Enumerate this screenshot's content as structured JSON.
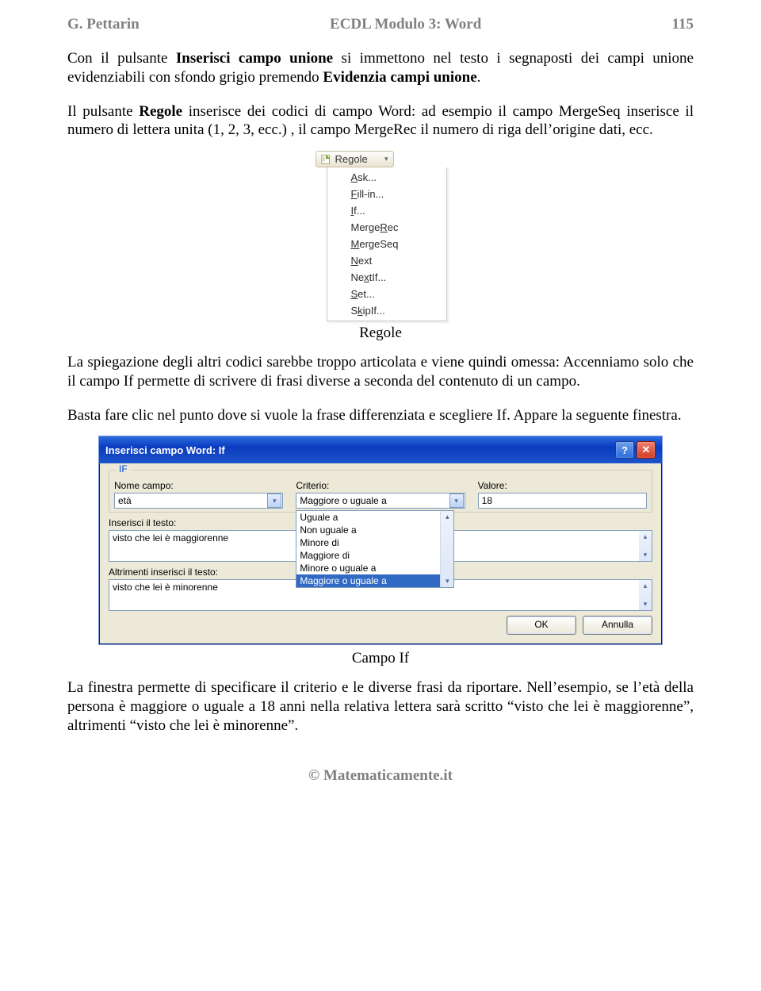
{
  "header": {
    "left": "G. Pettarin",
    "center": "ECDL Modulo 3: Word",
    "right": "115"
  },
  "para1_pre": "Con il pulsante ",
  "para1_b1": "Inserisci campo unione",
  "para1_mid": " si immettono nel testo i segnaposti dei campi unione evidenziabili con sfondo grigio premendo ",
  "para1_b2": "Evidenzia campi unione",
  "para1_end": ".",
  "para2_pre": "Il pulsante ",
  "para2_b1": "Regole",
  "para2_rest": " inserisce dei codici di campo Word: ad esempio il campo MergeSeq inserisce il numero di lettera unita (1, 2, 3, ecc.) , il campo MergeRec il numero di riga dell’origine dati, ecc.",
  "ribbon_label": "Regole",
  "menu": {
    "items": [
      "Ask...",
      "Fill-in...",
      "If...",
      "MergeRec",
      "MergeSeq",
      "Next",
      "NextIf...",
      "Set...",
      "SkipIf..."
    ],
    "uidx": [
      0,
      0,
      0,
      5,
      0,
      0,
      2,
      0,
      1
    ]
  },
  "caption1": "Regole",
  "para3": "La spiegazione degli altri codici sarebbe troppo articolata e viene quindi omessa: Accenniamo solo che il campo If permette di scrivere di frasi diverse a seconda del contenuto di un campo.",
  "para4": "Basta fare clic nel punto dove si vuole la frase differenziata e scegliere If. Appare la seguente finestra.",
  "dialog": {
    "title": "Inserisci campo Word: If",
    "group_legend": "IF",
    "labels": {
      "nome": "Nome campo:",
      "criterio": "Criterio:",
      "valore": "Valore:",
      "inserisci": "Inserisci il testo:",
      "altrimenti": "Altrimenti inserisci il testo:"
    },
    "nome_value": "età",
    "criterio_value": "Maggiore o uguale a",
    "criterio_options": [
      "Uguale a",
      "Non uguale a",
      "Minore di",
      "Maggiore di",
      "Minore o uguale a",
      "Maggiore o uguale a"
    ],
    "valore_value": "18",
    "inserisci_text": "visto che lei è maggiorenne",
    "altrimenti_text": "visto che lei è minorenne",
    "ok": "OK",
    "cancel": "Annulla"
  },
  "caption2": "Campo If",
  "para5": "La finestra permette di specificare il criterio e le diverse frasi da riportare. Nell’esempio, se l’età della persona è maggiore o uguale a 18 anni nella relativa lettera sarà scritto “visto che lei è maggiorenne”, altrimenti “visto che lei è minorenne”.",
  "footer": "© Matematicamente.it"
}
